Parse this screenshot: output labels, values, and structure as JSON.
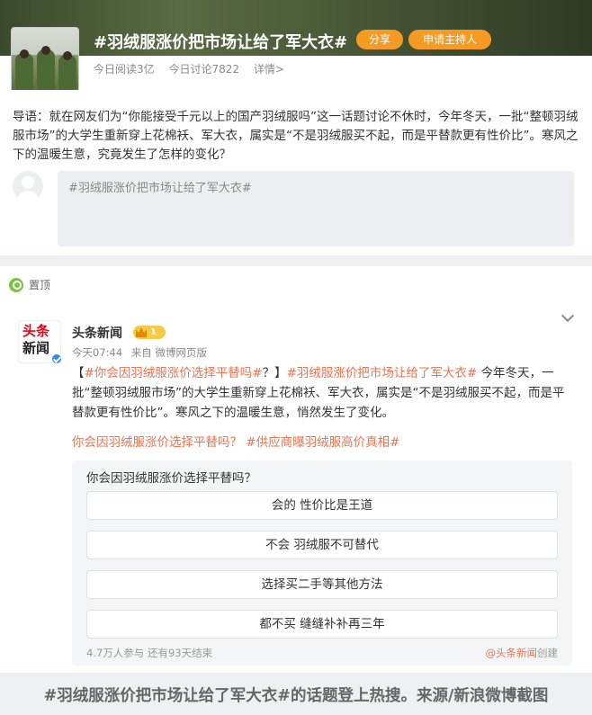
{
  "topic": {
    "title": "#羽绒服涨价把市场让给了军大衣#",
    "share_label": "分享",
    "host_label": "申请主持人",
    "stats": {
      "reads": "今日阅读3亿",
      "discussions": "今日讨论7822",
      "details": "详情>"
    }
  },
  "intro": {
    "text": "导语：就在网友们为“你能接受千元以上的国产羽绒服吗”这一话题讨论不休时，今年冬天，一批“整顿羽绒服市场”的大学生重新穿上花棉袄、军大衣，属实是“不是羽绒服买不起，而是平替款更有性价比”。寒风之下的温暖生意，究竟发生了怎样的变化？",
    "compose_placeholder": "#羽绒服涨价把市场让给了军大衣#"
  },
  "post": {
    "pinned_label": "置顶",
    "logo_line1": "头条",
    "logo_line2": "新闻",
    "author": "头条新闻",
    "vip_level": "1",
    "time": "今天07:44",
    "source": "来自 微博网页版",
    "body": {
      "bracket_open": "【",
      "tag1": "#你会因羽绒服涨价选择平替吗#",
      "question_mark": "？",
      "bracket_close": "】",
      "tag2": "#羽绒服涨价把市场让给了军大衣#",
      "text": " 今年冬天，一批“整顿羽绒服市场”的大学生重新穿上花棉袄、军大衣，属实是“不是羽绒服买不起，而是平替款更有性价比”。寒风之下的温暖生意，悄然发生了变化。"
    },
    "tags_line": "你会因羽绒服涨价选择平替吗？ #供应商曝羽绒服高价真相#"
  },
  "poll": {
    "question": "你会因羽绒服涨价选择平替吗？",
    "options": [
      "会的 性价比是王道",
      "不会 羽绒服不可替代",
      "选择买二手等其他方法",
      "都不买 缝缝补补再三年"
    ],
    "footer": "4.7万人参与 还有93天结束",
    "creator_link": "@头条新闻",
    "creator_suffix": "创建"
  },
  "caption": "#羽绒服涨价把市场让给了军大衣#的话题登上热搜。来源/新浪微博截图",
  "colors": {
    "accent_orange": "#f59a23",
    "link_orange": "#eb7350",
    "verified_blue": "#2c8be8",
    "pin_green": "#7bc142"
  }
}
